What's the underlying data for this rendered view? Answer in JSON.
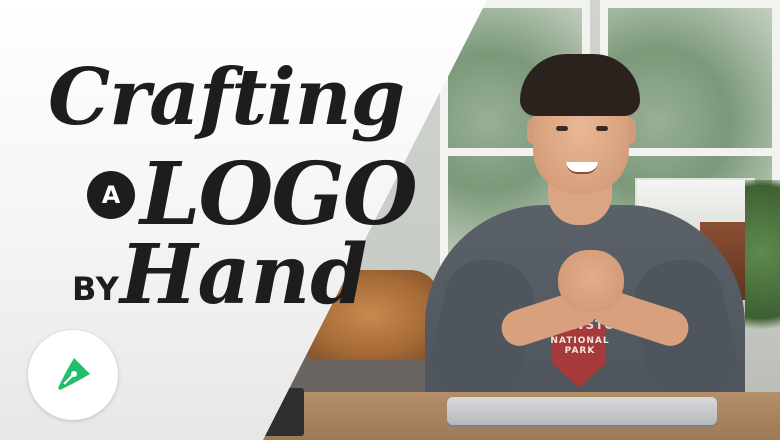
{
  "thumbnail": {
    "title_line1": "Crafting",
    "title_connector": "A",
    "title_line2": "LOGO",
    "title_by": "BY",
    "title_line3": "Hand",
    "shirt_text": "YELLOWSTONE",
    "shirt_subtext": "NATIONAL PARK",
    "brand_icon": "fountain-pen-nib-icon",
    "brand_color": "#1fbf6a"
  }
}
